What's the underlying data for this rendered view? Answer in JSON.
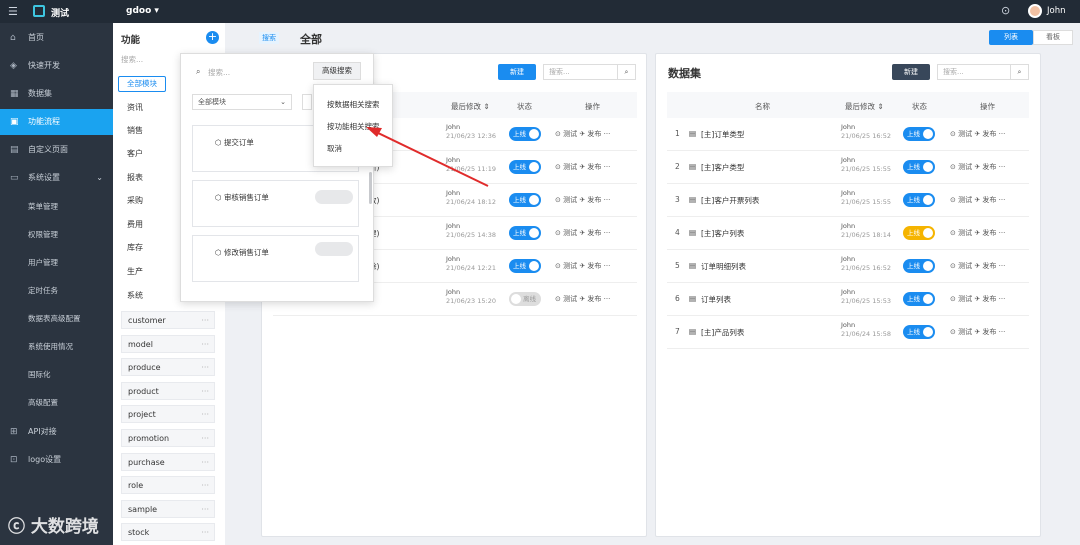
{
  "topbar": {
    "app_title": "测试",
    "project": "gdoo ▾",
    "user": "John"
  },
  "sidebar": {
    "items": [
      {
        "label": "首页",
        "icon": "home-icon"
      },
      {
        "label": "快速开发",
        "icon": "cube-icon"
      },
      {
        "label": "数据集",
        "icon": "grid-icon"
      },
      {
        "label": "功能流程",
        "icon": "flow-icon"
      },
      {
        "label": "自定义页面",
        "icon": "page-icon"
      },
      {
        "label": "系统设置",
        "icon": "monitor-icon"
      }
    ],
    "sub_items": [
      "菜单管理",
      "权限管理",
      "用户管理",
      "定时任务",
      "数据表高级配置",
      "系统使用情况",
      "国际化",
      "高级配置"
    ],
    "bottom_items": [
      {
        "label": "API对接",
        "icon": "api-icon"
      },
      {
        "label": "logo设置",
        "icon": "logo-icon"
      }
    ]
  },
  "func": {
    "title": "功能",
    "search_placeholder": "搜索...",
    "tab": "全部模块",
    "categories": [
      "资讯",
      "销售",
      "客户",
      "报表",
      "采购",
      "费用",
      "库存",
      "生产",
      "系统"
    ],
    "modules": [
      "customer",
      "model",
      "produce",
      "product",
      "project",
      "promotion",
      "purchase",
      "role",
      "sample",
      "stock"
    ]
  },
  "main": {
    "crumb_tag": "搜索",
    "crumb_title": "全部",
    "view_list": "列表",
    "view_board": "看板"
  },
  "left_panel": {
    "new_label": "新建",
    "search_placeholder": "搜索...",
    "headers": {
      "modified": "最后修改 ⇕",
      "status": "状态",
      "ops": "操作"
    },
    "rows": [
      {
        "frag": "",
        "user": "John",
        "time": "21/06/23 12:36",
        "status": "上线",
        "state": "on"
      },
      {
        "frag": "新)",
        "user": "John",
        "time": "21/06/25 11:19",
        "status": "上线",
        "state": "on"
      },
      {
        "frag": "改)",
        "user": "John",
        "time": "21/06/24 18:12",
        "status": "上线",
        "state": "on"
      },
      {
        "frag": "建)",
        "user": "John",
        "time": "21/06/25 14:38",
        "status": "上线",
        "state": "on"
      },
      {
        "frag": "除)",
        "user": "John",
        "time": "21/06/24 12:21",
        "status": "上线",
        "state": "on"
      },
      {
        "frag": "",
        "user": "John",
        "time": "21/06/23 15:20",
        "status": "离线",
        "state": "off"
      }
    ],
    "op_test": "测试",
    "op_publish": "发布"
  },
  "right_panel": {
    "title": "数据集",
    "new_label": "新建",
    "search_placeholder": "搜索...",
    "headers": {
      "name": "名称",
      "modified": "最后修改 ⇕",
      "status": "状态",
      "ops": "操作"
    },
    "rows": [
      {
        "idx": "1",
        "name": "[主]订单类型",
        "user": "John",
        "time": "21/06/25 16:52",
        "status": "上线",
        "state": "on"
      },
      {
        "idx": "2",
        "name": "[主]客户类型",
        "user": "John",
        "time": "21/06/25 15:55",
        "status": "上线",
        "state": "on"
      },
      {
        "idx": "3",
        "name": "[主]客户开票列表",
        "user": "John",
        "time": "21/06/25 15:55",
        "status": "上线",
        "state": "on"
      },
      {
        "idx": "4",
        "name": "[主]客户列表",
        "user": "John",
        "time": "21/06/25 18:14",
        "status": "上线",
        "state": "warn"
      },
      {
        "idx": "5",
        "name": "订单明细列表",
        "user": "John",
        "time": "21/06/25 16:52",
        "status": "上线",
        "state": "on"
      },
      {
        "idx": "6",
        "name": "订单列表",
        "user": "John",
        "time": "21/06/25 15:53",
        "status": "上线",
        "state": "on"
      },
      {
        "idx": "7",
        "name": "[主]产品列表",
        "user": "John",
        "time": "21/06/24 15:58",
        "status": "上线",
        "state": "on"
      }
    ],
    "op_test": "测试",
    "op_publish": "发布"
  },
  "popup": {
    "search_placeholder": "搜索...",
    "adv_search": "高级搜索",
    "module_select": "全部模块",
    "cards": [
      "提交订单",
      "审核销售订单",
      "修改销售订单"
    ]
  },
  "adv_menu": {
    "items": [
      "按数据相关搜索",
      "按功能相关搜索",
      "取消"
    ]
  },
  "watermark": "大数跨境"
}
